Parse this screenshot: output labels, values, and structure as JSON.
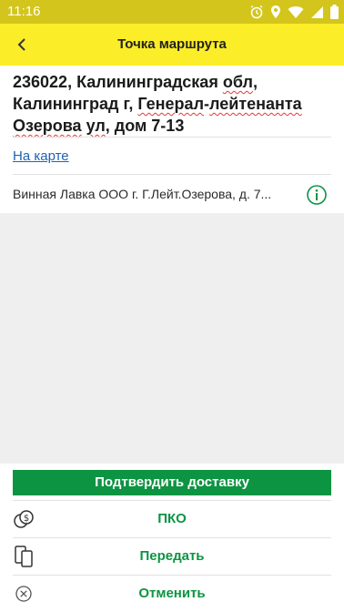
{
  "status_bar": {
    "time": "11:16",
    "icons": [
      "alarm-icon",
      "location-icon",
      "wifi-icon",
      "cell-signal-icon",
      "battery-icon"
    ]
  },
  "app_bar": {
    "title": "Точка маршрута",
    "back_icon": "back-arrow-icon"
  },
  "address": {
    "part1": "236022, Калининградская ",
    "word_obl": "обл",
    "part2": ", Калининград г, ",
    "word_general": "Генерал",
    "part3": "-",
    "word_lt": "лейтенанта",
    "part4": " ",
    "word_ozerova": "Озерова",
    "part5": " ",
    "word_ul": "ул",
    "part6": ", дом 7-13"
  },
  "map_link": "На карте",
  "client": {
    "text": "Винная Лавка ООО г. Г.Лейт.Озерова, д. 7...",
    "info_icon": "info-icon"
  },
  "actions": {
    "confirm": "Подтвердить доставку",
    "pko": "ПКО",
    "transfer": "Передать",
    "cancel": "Отменить"
  },
  "colors": {
    "status_bar": "#d3c51b",
    "app_bar": "#fbed27",
    "accent_green": "#0d9442",
    "link_blue": "#1e63b6",
    "background": "#efefef"
  }
}
